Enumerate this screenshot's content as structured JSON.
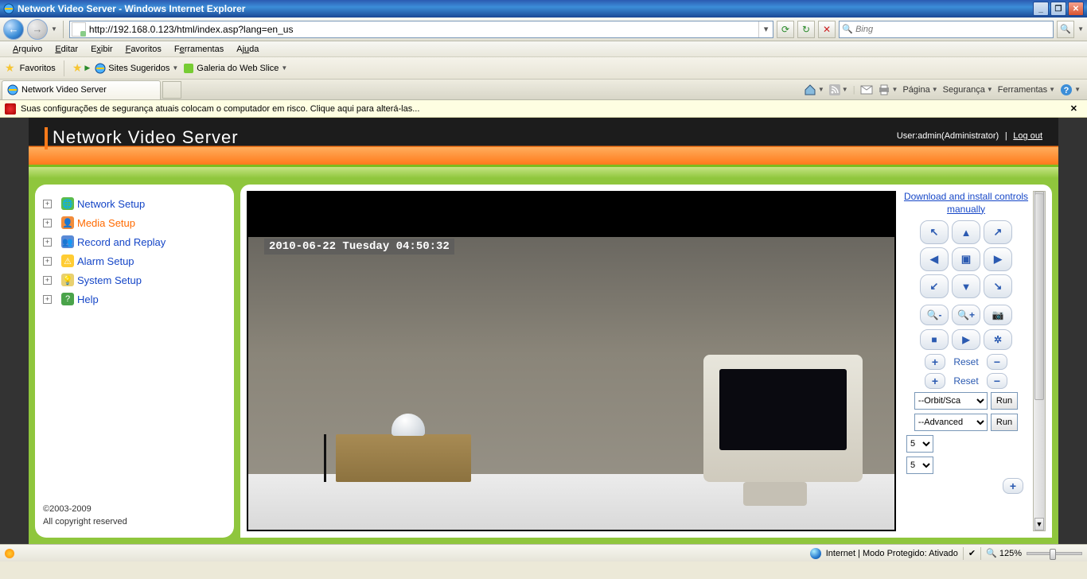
{
  "window": {
    "title": "Network Video Server - Windows Internet Explorer"
  },
  "nav": {
    "url": "http://192.168.0.123/html/index.asp?lang=en_us",
    "search_placeholder": "Bing"
  },
  "menu": {
    "items": [
      "Arquivo",
      "Editar",
      "Exibir",
      "Favoritos",
      "Ferramentas",
      "Ajuda"
    ]
  },
  "favbar": {
    "favorites_label": "Favoritos",
    "suggested_label": "Sites Sugeridos",
    "webslice_label": "Galeria do Web Slice"
  },
  "tab": {
    "title": "Network Video Server"
  },
  "cmdbar": {
    "page": "Página",
    "security": "Segurança",
    "tools": "Ferramentas"
  },
  "warn": {
    "text": "Suas configurações de segurança atuais colocam o computador em risco. Clique aqui para alterá-las..."
  },
  "header": {
    "logo": "Network Video  Server",
    "user_label": "User:",
    "user_value": "admin(Administrator)",
    "logout": "Log out"
  },
  "sidebar": {
    "items": [
      {
        "label": "Network Setup",
        "icon_bg": "#5bbb4b",
        "glyph": "🌐"
      },
      {
        "label": "Media Setup",
        "icon_bg": "#f28c3a",
        "glyph": "👤"
      },
      {
        "label": "Record and Replay",
        "icon_bg": "#5a8ad6",
        "glyph": "👥"
      },
      {
        "label": "Alarm Setup",
        "icon_bg": "#ffcc33",
        "glyph": "⚠"
      },
      {
        "label": "System Setup",
        "icon_bg": "#e8d070",
        "glyph": "💡"
      },
      {
        "label": "Help",
        "icon_bg": "#4aa34a",
        "glyph": "?"
      }
    ],
    "active_index": 1,
    "copyright_line1": "©2003-2009",
    "copyright_line2": "All copyright reserved"
  },
  "video": {
    "timestamp": "2010-06-22 Tuesday 04:50:32"
  },
  "controls": {
    "download_link": "Download and install controls manually",
    "reset_label": "Reset",
    "orbit_select": "--Orbit/Sca",
    "advanced_select": "--Advanced",
    "run_label": "Run",
    "num1": "5",
    "num2": "5"
  },
  "status": {
    "zone_text": "Internet | Modo Protegido: Ativado",
    "zoom": "125%"
  }
}
